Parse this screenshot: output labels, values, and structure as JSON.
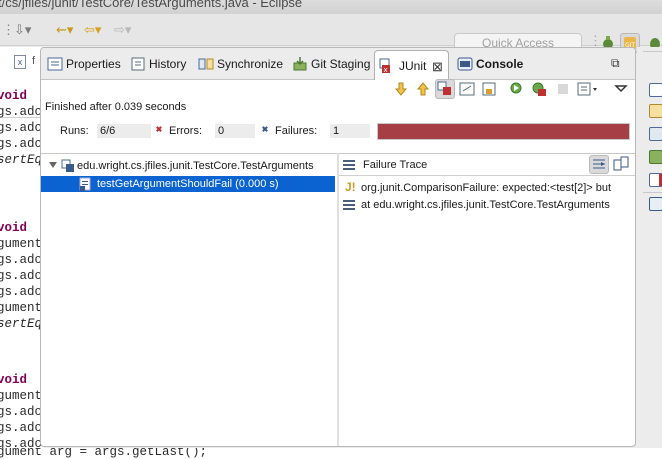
{
  "window": {
    "title": "t/cs/jfiles/junit/TestCore/TestArguments.java - Eclipse"
  },
  "toolbar": {
    "quick_access_placeholder": "Quick Access",
    "nav_back_icon": "back-arrow-icon",
    "nav_forward_icon": "forward-arrow-icon",
    "perspective_icons": [
      "java-perspective-icon",
      "debug-perspective-icon",
      "git-perspective-icon",
      "bug-icon"
    ]
  },
  "editor": {
    "tab_letter": "x",
    "tab_file_fragment": "f",
    "code_lines": [
      {
        "kind": "kw",
        "text": "void"
      },
      {
        "kind": "plain",
        "text": "gs.ado"
      },
      {
        "kind": "plain",
        "text": "gs.ado"
      },
      {
        "kind": "plain",
        "text": "gs.ado"
      },
      {
        "kind": "it",
        "text": "sertEq"
      },
      {
        "kind": "kw",
        "text": "void"
      },
      {
        "kind": "plain",
        "text": "gument"
      },
      {
        "kind": "plain",
        "text": "gs.ado"
      },
      {
        "kind": "plain",
        "text": "gs.ado"
      },
      {
        "kind": "plain",
        "text": "gs.ado"
      },
      {
        "kind": "plain",
        "text": "gument"
      },
      {
        "kind": "it",
        "text": "sertEq"
      },
      {
        "kind": "kw",
        "text": "void"
      },
      {
        "kind": "plain",
        "text": "gument"
      },
      {
        "kind": "plain",
        "text": "gs.ado"
      },
      {
        "kind": "plain",
        "text": "gs.ado"
      },
      {
        "kind": "plain",
        "text": "gs.ado"
      }
    ],
    "bottom_line": "gument arg = args.getLast();"
  },
  "tabs": [
    {
      "label": "Properties",
      "icon": "properties-icon",
      "active": false
    },
    {
      "label": "History",
      "icon": "history-icon",
      "active": false
    },
    {
      "label": "Synchronize",
      "icon": "synchronize-icon",
      "active": false
    },
    {
      "label": "Git Staging",
      "icon": "git-staging-icon",
      "active": false
    },
    {
      "label": "JUnit",
      "icon": "junit-icon",
      "active": true
    },
    {
      "label": "Console",
      "icon": "console-icon",
      "active": false
    }
  ],
  "junit": {
    "status": "Finished after 0.039 seconds",
    "runs_label": "Runs:",
    "runs_value": "6/6",
    "errors_label": "Errors:",
    "errors_value": "0",
    "failures_label": "Failures:",
    "failures_value": "1",
    "progress_fraction": 1.0,
    "progress_color": "#a53f45",
    "tree": {
      "suite": "edu.wright.cs.jfiles.junit.TestCore.TestArguments",
      "selected_case": "testGetArgumentShouldFail (0.000 s)"
    },
    "failure_trace": {
      "title": "Failure Trace",
      "lines": [
        "org.junit.ComparisonFailure: expected:<test[2]> but",
        "at edu.wright.cs.jfiles.junit.TestCore.TestArguments"
      ]
    }
  }
}
